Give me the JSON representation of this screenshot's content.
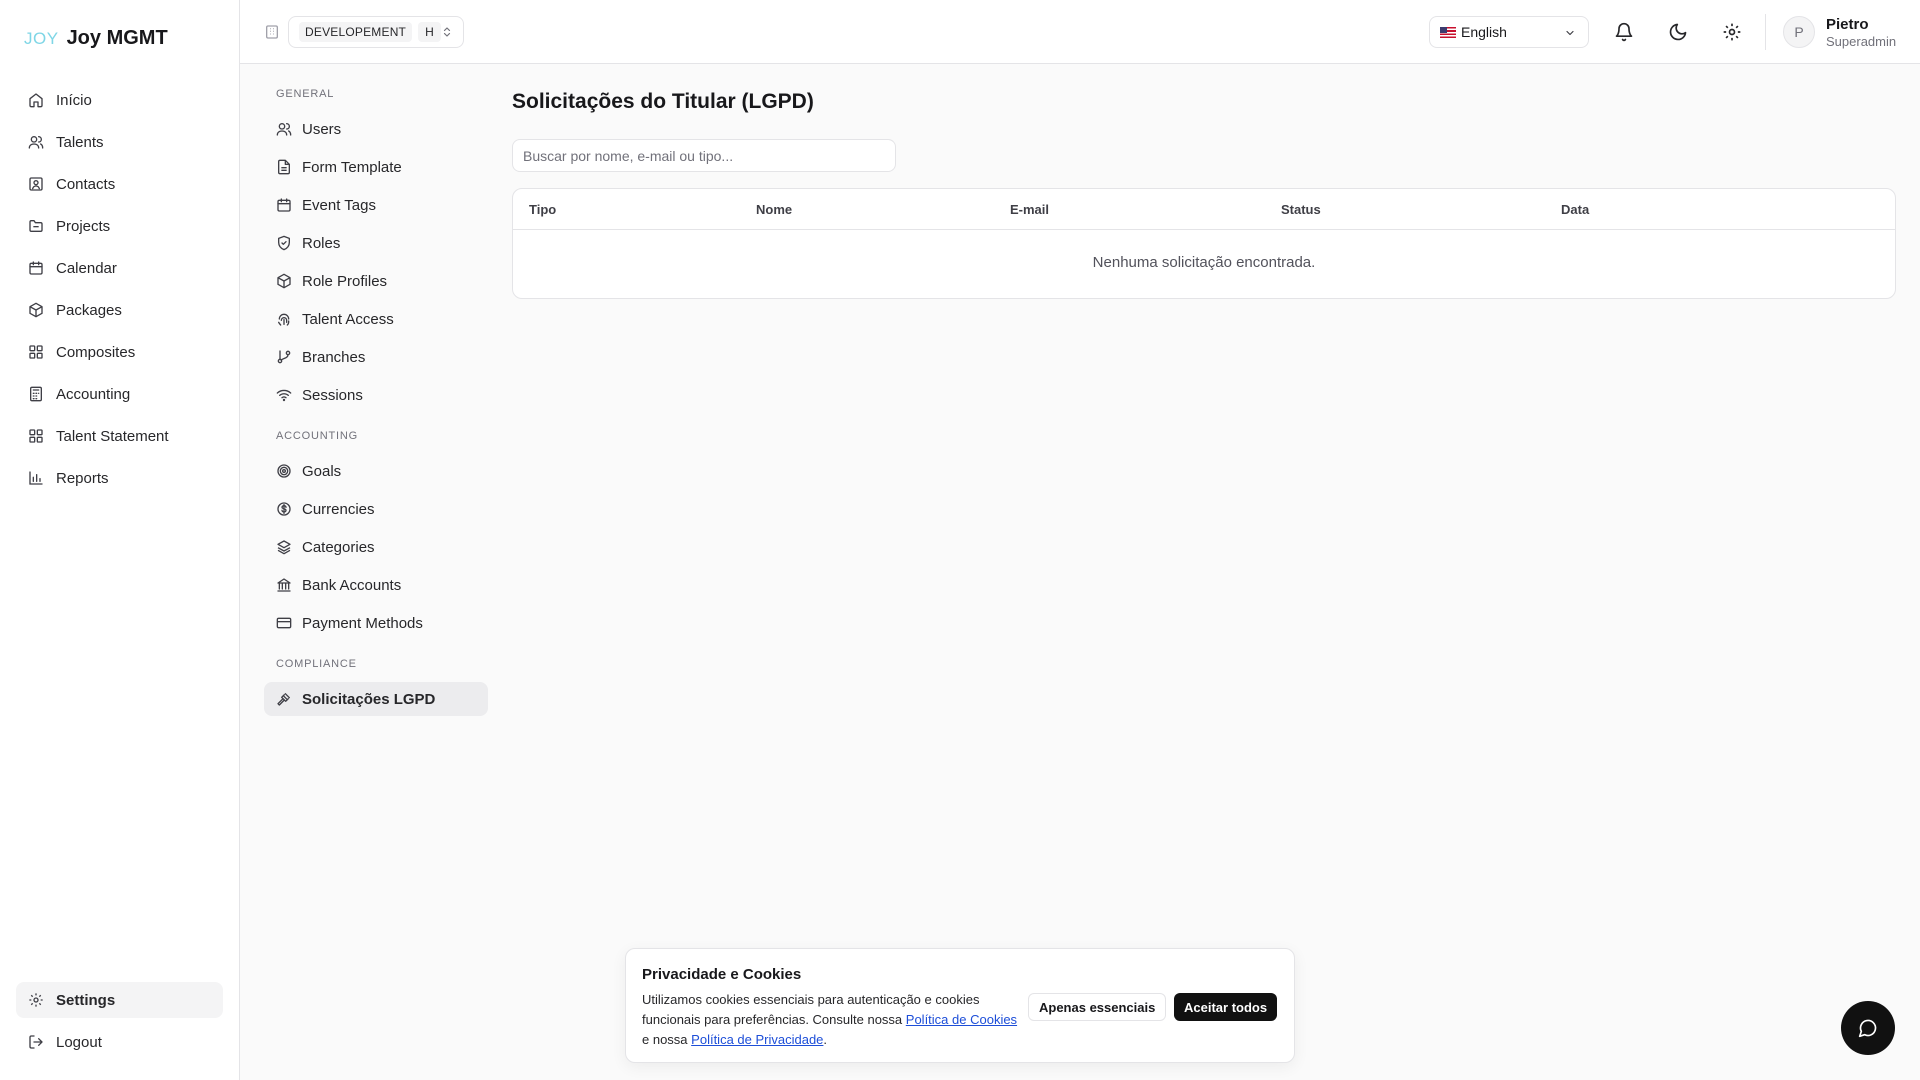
{
  "brand": {
    "mark": "JOY",
    "name": "Joy MGMT"
  },
  "sidebar": {
    "items": [
      {
        "label": "Início",
        "icon": "home-icon"
      },
      {
        "label": "Talents",
        "icon": "users-icon"
      },
      {
        "label": "Contacts",
        "icon": "contact-icon"
      },
      {
        "label": "Projects",
        "icon": "folder-icon"
      },
      {
        "label": "Calendar",
        "icon": "calendar-icon"
      },
      {
        "label": "Packages",
        "icon": "package-icon"
      },
      {
        "label": "Composites",
        "icon": "grid-icon"
      },
      {
        "label": "Accounting",
        "icon": "calculator-icon"
      },
      {
        "label": "Talent Statement",
        "icon": "grid-icon"
      },
      {
        "label": "Reports",
        "icon": "bar-chart-icon"
      }
    ],
    "bottom": {
      "settings": "Settings",
      "logout": "Logout"
    }
  },
  "topbar": {
    "environment": {
      "label": "DEVELOPEMENT",
      "badge": "H"
    },
    "language": {
      "label": "English",
      "flag": "us-flag"
    },
    "user": {
      "initial": "P",
      "name": "Pietro",
      "role": "Superadmin"
    }
  },
  "subnav": {
    "general_title": "GENERAL",
    "general": [
      "Users",
      "Form Template",
      "Event Tags",
      "Roles",
      "Role Profiles",
      "Talent Access",
      "Branches",
      "Sessions"
    ],
    "accounting_title": "ACCOUNTING",
    "accounting": [
      "Goals",
      "Currencies",
      "Categories",
      "Bank Accounts",
      "Payment Methods"
    ],
    "compliance_title": "COMPLIANCE",
    "compliance": [
      "Solicitações LGPD"
    ]
  },
  "main": {
    "title": "Solicitações do Titular (LGPD)",
    "search_placeholder": "Buscar por nome, e-mail ou tipo...",
    "columns": [
      "Tipo",
      "Nome",
      "E-mail",
      "Status",
      "Data"
    ],
    "empty_text": "Nenhuma solicitação encontrada."
  },
  "cookie": {
    "title": "Privacidade e Cookies",
    "text_1": "Utilizamos cookies essenciais para autenticação e cookies funcionais para preferências. Consulte nossa",
    "cookie_policy_link": "Política de Cookies",
    "text_2": "e nossa",
    "privacy_policy_link": "Política de Privacidade",
    "text_3": ".",
    "essential_button": "Apenas essenciais",
    "accept_button": "Aceitar todos"
  },
  "colors": {
    "active_bg": "#ececee",
    "primary_button": "#111111",
    "link": "#1d4ed8",
    "brand_mark": "#7fd6e6"
  }
}
